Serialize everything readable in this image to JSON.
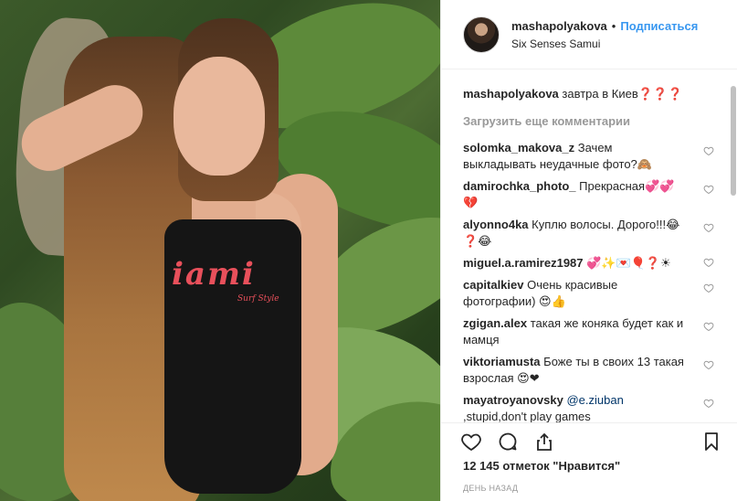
{
  "post": {
    "username": "mashapolyakova",
    "separator": "•",
    "follow_label": "Подписаться",
    "location": "Six Senses Samui"
  },
  "photo": {
    "swimsuit_text": "iami",
    "swimsuit_subtext": "Surf Style"
  },
  "caption": {
    "user": "mashapolyakova",
    "text": "завтра в Киев❓❓❓"
  },
  "load_more_label": "Загрузить еще комментарии",
  "comments": [
    {
      "user": "solomka_makova_z",
      "text": "Зачем выкладывать неудачные фото?🙈"
    },
    {
      "user": "damirochka_photo_",
      "text": "Прекрасная💞💞💔"
    },
    {
      "user": "alyonno4ka",
      "text": "Куплю волосы. Дорого!!!😂❓😂"
    },
    {
      "user": "miguel.a.ramirez1987",
      "text": "💞✨💌🎈❓☀"
    },
    {
      "user": "capitalkiev",
      "text": "Очень красивые фотографии) 😍👍"
    },
    {
      "user": "zgigan.alex",
      "text": "такая же коняка будет как и мамця"
    },
    {
      "user": "viktoriamusta",
      "text": "Боже ты в своих 13 такая взрослая 😍❤"
    },
    {
      "user": "mayatroyanovsky",
      "mention": "@e.ziuban",
      "text": ",stupid,don't play games"
    }
  ],
  "likes_text": "12 145 отметок \"Нравится\"",
  "timestamp": "День назад",
  "icons": [
    "heart-icon",
    "comment-icon",
    "share-icon",
    "bookmark-icon",
    "like-comment-icon"
  ],
  "colors": {
    "follow": "#3897f0",
    "muted": "#999999",
    "text": "#262626",
    "mention": "#003569"
  }
}
